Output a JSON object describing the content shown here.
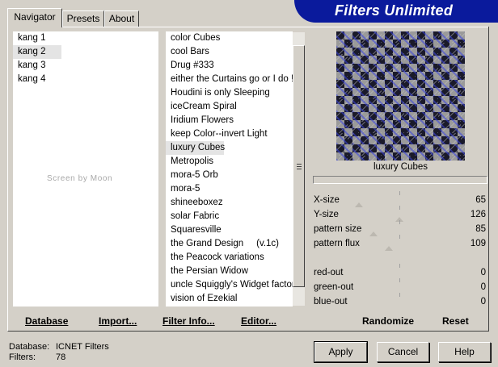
{
  "app": {
    "title": "Filters Unlimited"
  },
  "tabs": [
    {
      "label": "Navigator",
      "active": true
    },
    {
      "label": "Presets",
      "active": false
    },
    {
      "label": "About",
      "active": false
    }
  ],
  "categories": {
    "items": [
      "kang 1",
      "kang 2",
      "kang 3",
      "kang 4"
    ],
    "selected": "kang 2"
  },
  "watermark": "Screen by Moon",
  "filters": {
    "items": [
      "color Cubes",
      "cool Bars",
      "Drug #333",
      "either the Curtains go or I do !",
      "Houdini is only Sleeping",
      "iceCream Spiral",
      "Iridium Flowers",
      "keep Color--invert Light",
      "luxury Cubes",
      "Metropolis",
      "mora-5 Orb",
      "mora-5",
      "shineeboxez",
      "solar Fabric",
      "Squaresville",
      "the Grand Design     (v.1c)",
      "the Peacock variations",
      "the Persian Widow",
      "uncle Squiggly's Widget factory",
      "vision of Ezekial"
    ],
    "selected": "luxury Cubes"
  },
  "toolbar": {
    "database": "Database",
    "import": "Import...",
    "filter_info": "Filter Info...",
    "editor": "Editor..."
  },
  "preview": {
    "effect_name": "luxury Cubes",
    "colors": {
      "tile_light": "#9a9a9a",
      "tile_dark": "#1a1a2a",
      "accent": "#3c46dc"
    }
  },
  "sliders": [
    {
      "label": "X-size",
      "value": "65"
    },
    {
      "label": "Y-size",
      "value": "126"
    },
    {
      "label": "pattern size",
      "value": "85"
    },
    {
      "label": "pattern flux",
      "value": "109"
    },
    {
      "label": "red-out",
      "value": "0"
    },
    {
      "label": "green-out",
      "value": "0"
    },
    {
      "label": "blue-out",
      "value": "0"
    }
  ],
  "actions": {
    "randomize": "Randomize",
    "reset": "Reset"
  },
  "footer": {
    "database_label": "Database:",
    "database_value": "ICNET Filters",
    "filters_label": "Filters:",
    "filters_value": "78"
  },
  "buttons": {
    "apply": "Apply",
    "cancel": "Cancel",
    "help": "Help"
  },
  "theme": {
    "face": "#d4d0c8",
    "banner": "#0a1a9c"
  }
}
